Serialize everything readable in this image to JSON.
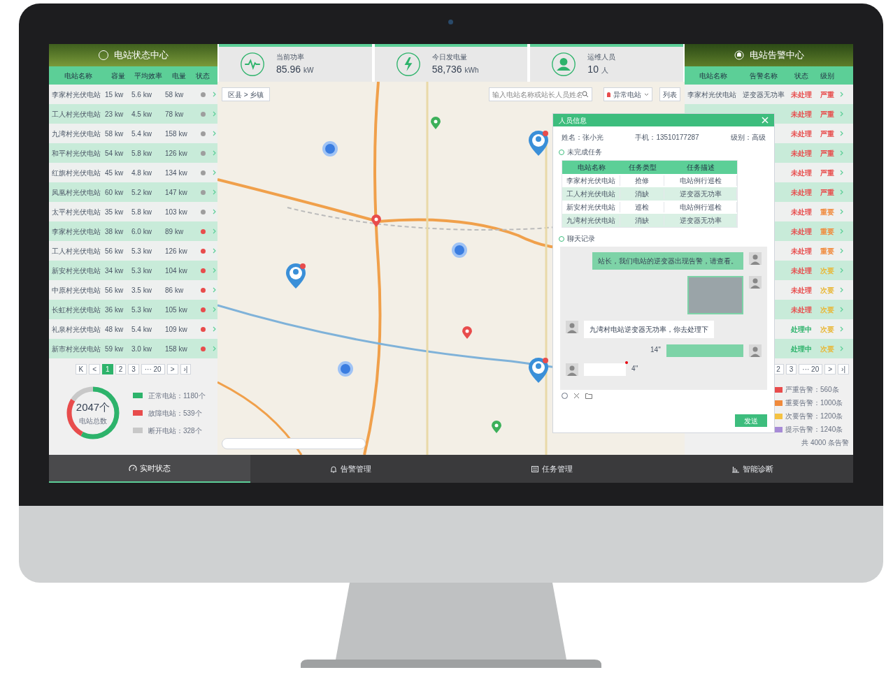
{
  "left_panel": {
    "title": "电站状态中心",
    "columns": [
      "电站名称",
      "容量",
      "平均效率",
      "电量",
      "状态"
    ],
    "rows": [
      {
        "cells": [
          "李家村光伏电站",
          "15 kw",
          "5.6 kw",
          "58 kw"
        ],
        "color": "#9e9e9e"
      },
      {
        "cells": [
          "工人村光伏电站",
          "23 kw",
          "4.5 kw",
          "78 kw"
        ],
        "color": "#9e9e9e"
      },
      {
        "cells": [
          "九湾村光伏电站",
          "58 kw",
          "5.4 kw",
          "158 kw"
        ],
        "color": "#9e9e9e"
      },
      {
        "cells": [
          "和平村光伏电站",
          "54 kw",
          "5.8 kw",
          "126 kw"
        ],
        "color": "#9e9e9e"
      },
      {
        "cells": [
          "红旗村光伏电站",
          "45 kw",
          "4.8 kw",
          "134 kw"
        ],
        "color": "#9e9e9e"
      },
      {
        "cells": [
          "凤凰村光伏电站",
          "60 kw",
          "5.2 kw",
          "147 kw"
        ],
        "color": "#9e9e9e"
      },
      {
        "cells": [
          "太平村光伏电站",
          "35 kw",
          "5.8 kw",
          "103 kw"
        ],
        "color": "#9e9e9e"
      },
      {
        "cells": [
          "李家村光伏电站",
          "38 kw",
          "6.0 kw",
          "89 kw"
        ],
        "color": "#e84c4c"
      },
      {
        "cells": [
          "工人村光伏电站",
          "56 kw",
          "5.3 kw",
          "126 kw"
        ],
        "color": "#e84c4c"
      },
      {
        "cells": [
          "新安村光伏电站",
          "34 kw",
          "5.3 kw",
          "104 kw"
        ],
        "color": "#e84c4c"
      },
      {
        "cells": [
          "中原村光伏电站",
          "56 kw",
          "3.5 kw",
          "86 kw"
        ],
        "color": "#e84c4c"
      },
      {
        "cells": [
          "长虹村光伏电站",
          "36 kw",
          "5.3 kw",
          "105 kw"
        ],
        "color": "#e84c4c"
      },
      {
        "cells": [
          "礼泉村光伏电站",
          "48 kw",
          "5.4 kw",
          "109 kw"
        ],
        "color": "#e84c4c"
      },
      {
        "cells": [
          "新市村光伏电站",
          "59 kw",
          "3.0 kw",
          "158 kw"
        ],
        "color": "#e84c4c"
      }
    ],
    "pagination": [
      {
        "label": "K",
        "selected": false
      },
      {
        "label": "<",
        "selected": false
      },
      {
        "label": "1",
        "selected": true
      },
      {
        "label": "2",
        "selected": false
      },
      {
        "label": "3",
        "selected": false
      },
      {
        "label": "··· 20",
        "selected": false
      },
      {
        "label": ">",
        "selected": false
      },
      {
        "label": "›|",
        "selected": false
      }
    ],
    "summary": {
      "total": "2047个",
      "caption": "电站总数",
      "legend": [
        {
          "label": "正常电站：1180个",
          "color": "#2db36b"
        },
        {
          "label": "故障电站：539个",
          "color": "#e84c4c"
        },
        {
          "label": "断开电站：328个",
          "color": "#c8c8c8"
        }
      ]
    }
  },
  "stats": [
    {
      "label": "当前功率",
      "value": "85.96",
      "unit": "kW",
      "kind": "pulse"
    },
    {
      "label": "今日发电量",
      "value": "58,736",
      "unit": "kWh",
      "kind": "bolt"
    },
    {
      "label": "运维人员",
      "value": "10",
      "unit": "人",
      "kind": "person"
    }
  ],
  "map": {
    "breadcrumb": "区县 > 乡镇",
    "search": {
      "placeholder": "输入电站名称或站长人员姓名"
    },
    "filter": "异常电站",
    "list_button": "列表"
  },
  "popup": {
    "title": "人员信息",
    "name": "姓名：张小光",
    "phone": "手机：13510177287",
    "level": "级别：高级",
    "tasks_title": "未完成任务",
    "task_columns": [
      "电站名称",
      "任务类型",
      "任务描述"
    ],
    "tasks": [
      [
        "李家村光伏电站",
        "抢修",
        "电站例行巡检"
      ],
      [
        "工人村光伏电站",
        "消缺",
        "逆变器无功率"
      ],
      [
        "新安村光伏电站",
        "巡检",
        "电站例行巡检"
      ],
      [
        "九湾村光伏电站",
        "消缺",
        "逆变器无功率"
      ]
    ],
    "chat_title": "聊天记录",
    "messages": [
      {
        "kind": "text",
        "outgoing": true,
        "text": "站长，我们电站的逆变器出现告警，请查看。"
      },
      {
        "kind": "image",
        "outgoing": true
      },
      {
        "kind": "text",
        "outgoing": false,
        "text": "九湾村电站逆变器无功率，你去处理下"
      },
      {
        "kind": "voice",
        "outgoing": true,
        "duration": "14''",
        "unread": false
      },
      {
        "kind": "voice",
        "outgoing": false,
        "duration": "4''",
        "unread": true
      }
    ],
    "send": "发送"
  },
  "right_panel": {
    "title": "电站告警中心",
    "columns": [
      "电站名称",
      "告警名称",
      "状态",
      "级别"
    ],
    "rows": [
      {
        "station": "李家村光伏电站",
        "alarm": "逆变器无功率",
        "status": {
          "text": "未处理",
          "color": "#e84c4c"
        },
        "level": {
          "text": "严重",
          "color": "#e84c4c"
        }
      },
      {
        "status": {
          "text": "未处理",
          "color": "#e84c4c"
        },
        "level": {
          "text": "严重",
          "color": "#e84c4c"
        }
      },
      {
        "status": {
          "text": "未处理",
          "color": "#e84c4c"
        },
        "level": {
          "text": "严重",
          "color": "#e84c4c"
        }
      },
      {
        "status": {
          "text": "未处理",
          "color": "#e84c4c"
        },
        "level": {
          "text": "严重",
          "color": "#e84c4c"
        }
      },
      {
        "status": {
          "text": "未处理",
          "color": "#e84c4c"
        },
        "level": {
          "text": "严重",
          "color": "#e84c4c"
        }
      },
      {
        "status": {
          "text": "未处理",
          "color": "#e84c4c"
        },
        "level": {
          "text": "严重",
          "color": "#e84c4c"
        }
      },
      {
        "status": {
          "text": "未处理",
          "color": "#e84c4c"
        },
        "level": {
          "text": "重要",
          "color": "#f08a3c"
        }
      },
      {
        "status": {
          "text": "未处理",
          "color": "#e84c4c"
        },
        "level": {
          "text": "重要",
          "color": "#f08a3c"
        }
      },
      {
        "status": {
          "text": "未处理",
          "color": "#e84c4c"
        },
        "level": {
          "text": "重要",
          "color": "#f08a3c"
        }
      },
      {
        "status": {
          "text": "未处理",
          "color": "#e84c4c"
        },
        "level": {
          "text": "次要",
          "color": "#e8b83a"
        }
      },
      {
        "status": {
          "text": "未处理",
          "color": "#e84c4c"
        },
        "level": {
          "text": "次要",
          "color": "#e8b83a"
        }
      },
      {
        "status": {
          "text": "未处理",
          "color": "#e84c4c"
        },
        "level": {
          "text": "次要",
          "color": "#e8b83a"
        }
      },
      {
        "status": {
          "text": "处理中",
          "color": "#2db36b"
        },
        "level": {
          "text": "次要",
          "color": "#e8b83a"
        }
      },
      {
        "status": {
          "text": "处理中",
          "color": "#2db36b"
        },
        "level": {
          "text": "次要",
          "color": "#e8b83a"
        }
      }
    ],
    "pagination": [
      {
        "label": "2",
        "selected": false
      },
      {
        "label": "3",
        "selected": false
      },
      {
        "label": "··· 20",
        "selected": false
      },
      {
        "label": ">",
        "selected": false
      },
      {
        "label": "›|",
        "selected": false
      }
    ],
    "legend": [
      {
        "label": "严重告警：560条",
        "color": "#e84c4c"
      },
      {
        "label": "重要告警：1000条",
        "color": "#f08a3c"
      },
      {
        "label": "次要告警：1200条",
        "color": "#f5c242"
      },
      {
        "label": "提示告警：1240条",
        "color": "#a78bd6"
      }
    ],
    "total": "共 4000 条告警"
  },
  "nav": [
    {
      "label": "实时状态",
      "selected": true,
      "kind": "gauge"
    },
    {
      "label": "告警管理",
      "selected": false,
      "kind": "bell"
    },
    {
      "label": "任务管理",
      "selected": false,
      "kind": "list"
    },
    {
      "label": "智能诊断",
      "selected": false,
      "kind": "chart"
    }
  ]
}
